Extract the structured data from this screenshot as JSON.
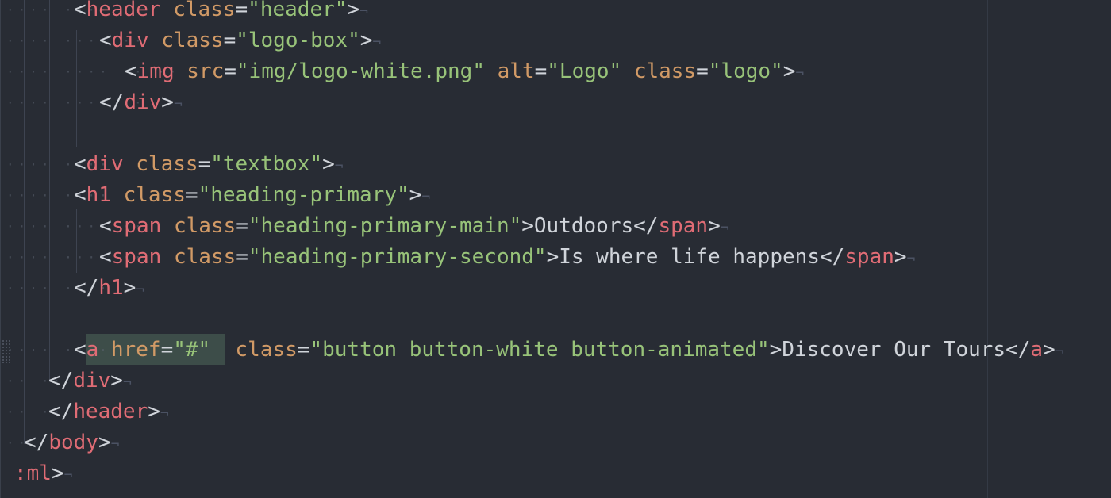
{
  "editor": {
    "theme_colors": {
      "background": "#282c34",
      "tag": "#e06c75",
      "attribute": "#d19a66",
      "string": "#98c379",
      "text": "#d0d4da",
      "selection": "#3d4d49"
    },
    "lines": [
      {
        "text": "<header class=\"header\">"
      },
      {
        "text": "<div class=\"logo-box\">"
      },
      {
        "text": "<img src=\"img/logo-white.png\" alt=\"Logo\" class=\"logo\">"
      },
      {
        "text": "</div>"
      },
      {
        "text": ""
      },
      {
        "text": "<div class=\"textbox\">"
      },
      {
        "text": "<h1 class=\"heading-primary\">"
      },
      {
        "text": "<span class=\"heading-primary-main\">Outdoors</span>"
      },
      {
        "text": "<span class=\"heading-primary-second\">Is where life happens</span>"
      },
      {
        "text": "</h1>"
      },
      {
        "text": ""
      },
      {
        "text": "<a href=\"#\" class=\"button button-white button-animated\">Discover Our Tours</a>"
      },
      {
        "text": "</div>"
      },
      {
        "text": "</header>"
      },
      {
        "text": "</body>"
      },
      {
        "text": ":ml>"
      }
    ],
    "eol_marker": "¬",
    "indent_marker": "·",
    "selected_text": "a href=\"#\" "
  }
}
